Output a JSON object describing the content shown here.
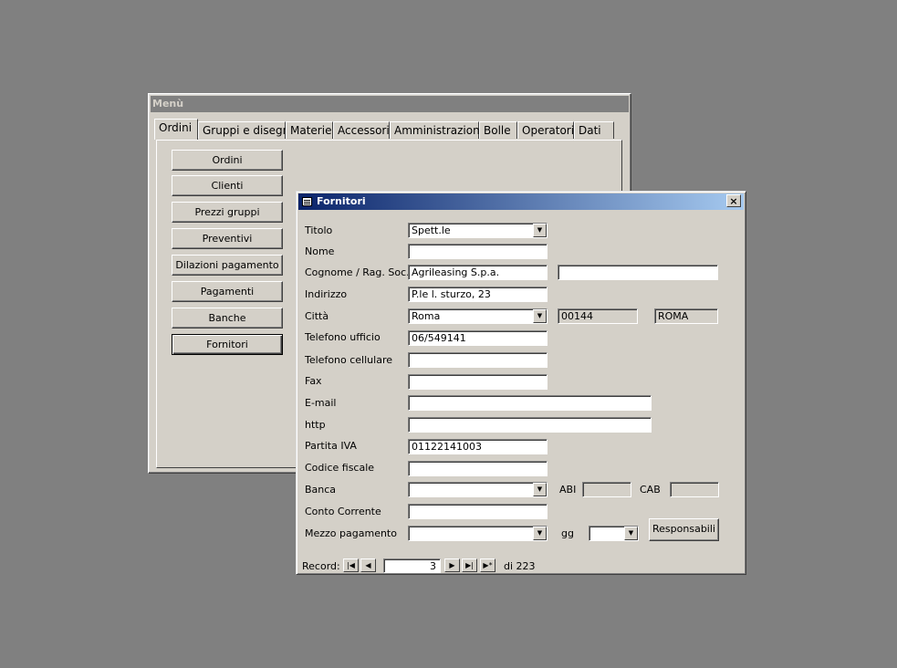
{
  "menu_window": {
    "title": "Menù",
    "tabs": [
      "Ordini",
      "Gruppi e disegni",
      "Materie",
      "Accessori",
      "Amministrazione",
      "Bolle",
      "Operatori",
      "Dati"
    ],
    "active_tab": "Ordini",
    "buttons": [
      "Ordini",
      "Clienti",
      "Prezzi gruppi",
      "Preventivi",
      "Dilazioni pagamento",
      "Pagamenti",
      "Banche",
      "Fornitori"
    ],
    "focused_button": "Fornitori",
    "logo_icon": "company-logo-icon"
  },
  "fornitori_window": {
    "title": "Fornitori",
    "close_label": "×",
    "fields": {
      "titolo": {
        "label": "Titolo",
        "value": "Spett.le"
      },
      "nome": {
        "label": "Nome",
        "value": ""
      },
      "cognome": {
        "label": "Cognome / Rag. Soc.",
        "value": "Agrileasing S.p.a.",
        "value2": ""
      },
      "indirizzo": {
        "label": "Indirizzo",
        "value": "P.le l. sturzo, 23"
      },
      "citta": {
        "label": "Città",
        "value": "Roma",
        "cap": "00144",
        "provincia": "ROMA"
      },
      "telefono_ufficio": {
        "label": "Telefono ufficio",
        "value": "06/549141"
      },
      "telefono_cellulare": {
        "label": "Telefono cellulare",
        "value": ""
      },
      "fax": {
        "label": "Fax",
        "value": ""
      },
      "email": {
        "label": "E-mail",
        "value": ""
      },
      "http": {
        "label": "http",
        "value": ""
      },
      "partita_iva": {
        "label": "Partita IVA",
        "value": "01122141003"
      },
      "codice_fiscale": {
        "label": "Codice fiscale",
        "value": ""
      },
      "banca": {
        "label": "Banca",
        "value": "",
        "abi_label": "ABI",
        "abi_value": "",
        "cab_label": "CAB",
        "cab_value": ""
      },
      "conto_corrente": {
        "label": "Conto Corrente",
        "value": ""
      },
      "mezzo_pagamento": {
        "label": "Mezzo pagamento",
        "value": "",
        "gg_label": "gg",
        "gg_value": ""
      }
    },
    "responsabili_button": "Responsabili",
    "record_nav": {
      "label": "Record:",
      "current": "3",
      "total_text": "di 223",
      "first_icon": "first-record-icon",
      "prev_icon": "prev-record-icon",
      "next_icon": "next-record-icon",
      "last_icon": "last-record-icon",
      "new_icon": "new-record-icon"
    }
  },
  "colors": {
    "desktop": "#808080",
    "window_face": "#d4d0c8",
    "title_active_start": "#0a246a",
    "title_active_end": "#a6caf0",
    "title_inactive": "#808080",
    "logo_blue": "#1f3f8f",
    "logo_red": "#d2232a"
  }
}
